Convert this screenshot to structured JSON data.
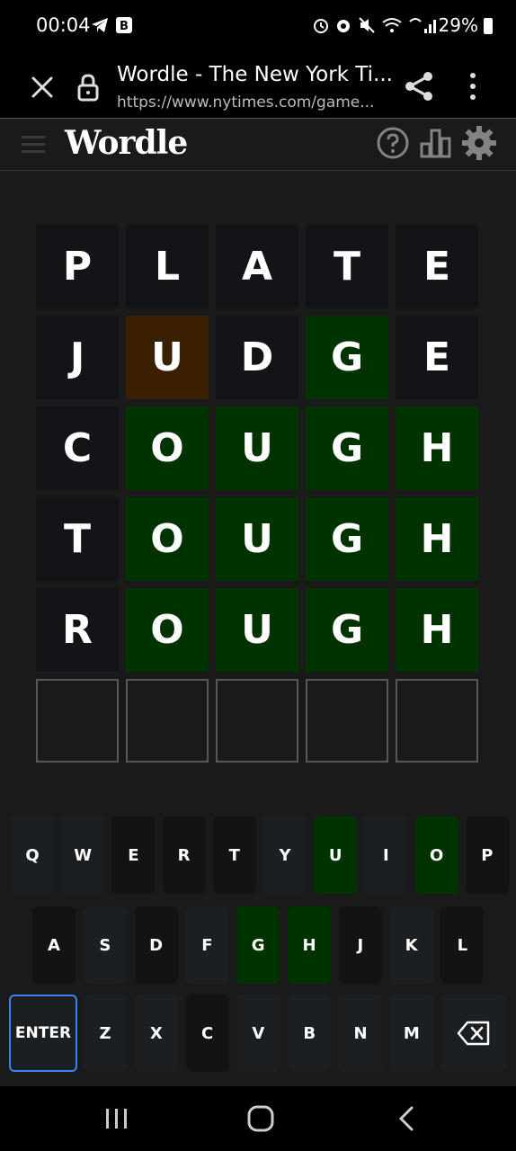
{
  "status_bar": {
    "time": "00:04",
    "battery": "29%"
  },
  "browser": {
    "title": "Wordle - The New York Ti...",
    "url": "https://www.nytimes.com/game..."
  },
  "game": {
    "title": "Wordle"
  },
  "board": [
    [
      {
        "l": "P",
        "s": "absent"
      },
      {
        "l": "L",
        "s": "absent"
      },
      {
        "l": "A",
        "s": "absent"
      },
      {
        "l": "T",
        "s": "absent"
      },
      {
        "l": "E",
        "s": "absent"
      }
    ],
    [
      {
        "l": "J",
        "s": "absent"
      },
      {
        "l": "U",
        "s": "present"
      },
      {
        "l": "D",
        "s": "absent"
      },
      {
        "l": "G",
        "s": "correct"
      },
      {
        "l": "E",
        "s": "absent"
      }
    ],
    [
      {
        "l": "C",
        "s": "absent"
      },
      {
        "l": "O",
        "s": "correct"
      },
      {
        "l": "U",
        "s": "correct"
      },
      {
        "l": "G",
        "s": "correct"
      },
      {
        "l": "H",
        "s": "correct"
      }
    ],
    [
      {
        "l": "T",
        "s": "absent"
      },
      {
        "l": "O",
        "s": "correct"
      },
      {
        "l": "U",
        "s": "correct"
      },
      {
        "l": "G",
        "s": "correct"
      },
      {
        "l": "H",
        "s": "correct"
      }
    ],
    [
      {
        "l": "R",
        "s": "absent"
      },
      {
        "l": "O",
        "s": "correct"
      },
      {
        "l": "U",
        "s": "correct"
      },
      {
        "l": "G",
        "s": "correct"
      },
      {
        "l": "H",
        "s": "correct"
      }
    ],
    [
      {
        "l": "",
        "s": "empty"
      },
      {
        "l": "",
        "s": "empty"
      },
      {
        "l": "",
        "s": "empty"
      },
      {
        "l": "",
        "s": "empty"
      },
      {
        "l": "",
        "s": "empty"
      }
    ]
  ],
  "keyboard": {
    "row1": [
      {
        "k": "Q",
        "s": "unused"
      },
      {
        "k": "W",
        "s": "unused"
      },
      {
        "k": "E",
        "s": "absent"
      },
      {
        "k": "R",
        "s": "absent"
      },
      {
        "k": "T",
        "s": "absent"
      },
      {
        "k": "Y",
        "s": "unused"
      },
      {
        "k": "U",
        "s": "correct"
      },
      {
        "k": "I",
        "s": "unused"
      },
      {
        "k": "O",
        "s": "correct"
      },
      {
        "k": "P",
        "s": "absent"
      }
    ],
    "row2": [
      {
        "k": "A",
        "s": "absent"
      },
      {
        "k": "S",
        "s": "unused"
      },
      {
        "k": "D",
        "s": "absent"
      },
      {
        "k": "F",
        "s": "unused"
      },
      {
        "k": "G",
        "s": "correct"
      },
      {
        "k": "H",
        "s": "correct"
      },
      {
        "k": "J",
        "s": "absent"
      },
      {
        "k": "K",
        "s": "unused"
      },
      {
        "k": "L",
        "s": "absent"
      }
    ],
    "row3": [
      {
        "k": "ENTER",
        "s": "enter"
      },
      {
        "k": "Z",
        "s": "unused"
      },
      {
        "k": "X",
        "s": "unused"
      },
      {
        "k": "C",
        "s": "absent"
      },
      {
        "k": "V",
        "s": "unused"
      },
      {
        "k": "B",
        "s": "unused"
      },
      {
        "k": "N",
        "s": "unused"
      },
      {
        "k": "M",
        "s": "unused"
      },
      {
        "k": "backspace-icon",
        "s": "icon"
      }
    ]
  },
  "colors": {
    "correct": "#013301",
    "present": "#3a2000",
    "absent": "#121417",
    "key_default": "#1c1f22",
    "enter_border": "#3b82f6"
  }
}
